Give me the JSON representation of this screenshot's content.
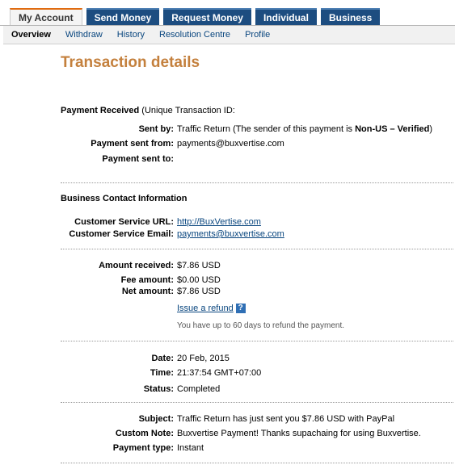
{
  "tabs": [
    "My Account",
    "Send Money",
    "Request Money",
    "Individual",
    "Business"
  ],
  "subnav": [
    "Overview",
    "Withdraw",
    "History",
    "Resolution Centre",
    "Profile"
  ],
  "page_title": "Transaction details",
  "payment": {
    "heading": "Payment Received",
    "heading_suffix": "(Unique Transaction ID:",
    "sent_by_label": "Sent by:",
    "sent_by_prefix": "Traffic Return (The sender of this payment is ",
    "sent_by_status": "Non-US – Verified",
    "sent_by_suffix": ")",
    "sent_from_label": "Payment sent from:",
    "sent_from_value": "payments@buxvertise.com",
    "sent_to_label": "Payment sent to:"
  },
  "business": {
    "heading": "Business Contact Information",
    "url_label": "Customer Service URL:",
    "url_value": "http://BuxVertise.com",
    "email_label": "Customer Service Email:",
    "email_value": "payments@buxvertise.com"
  },
  "amounts": {
    "received_label": "Amount received:",
    "received_value": "$7.86 USD",
    "fee_label": "Fee amount:",
    "fee_value": "$0.00 USD",
    "net_label": "Net amount:",
    "net_value": "$7.86 USD",
    "refund_link": "Issue a refund",
    "help_glyph": "?",
    "refund_note": "You have up to 60 days to refund the payment."
  },
  "details": {
    "date_label": "Date:",
    "date_value": "20 Feb, 2015",
    "time_label": "Time:",
    "time_value": "21:37:54 GMT+07:00",
    "status_label": "Status:",
    "status_value": "Completed"
  },
  "message": {
    "subject_label": "Subject:",
    "subject_value": "Traffic Return has just sent you $7.86 USD with PayPal",
    "note_label": "Custom Note:",
    "note_value": "Buxvertise Payment! Thanks supachaing for using Buxvertise.",
    "type_label": "Payment type:",
    "type_value": "Instant"
  }
}
